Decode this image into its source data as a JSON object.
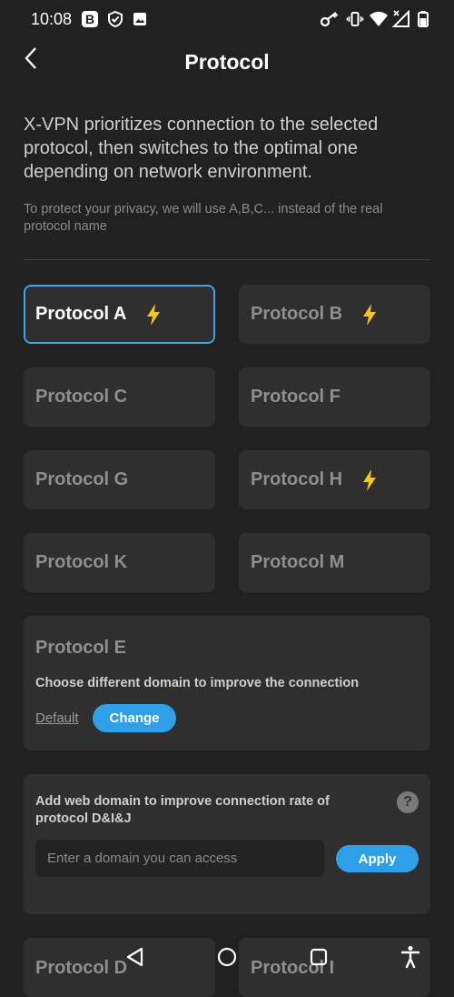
{
  "status_bar": {
    "time": "10:08",
    "badge_letter": "B",
    "left_icons": [
      "b-badge-icon",
      "shield-check-icon",
      "image-icon"
    ],
    "right_icons": [
      "key-icon",
      "vibrate-icon",
      "wifi-icon",
      "signal-icon",
      "battery-icon"
    ]
  },
  "header": {
    "title": "Protocol",
    "back_icon": "chevron-left-icon"
  },
  "intro": "X-VPN prioritizes connection to the selected protocol, then switches to the optimal one depending on network environment.",
  "privacy_note": "To protect your privacy, we will use A,B,C... instead of the real protocol name",
  "protocols": [
    {
      "label": "Protocol A",
      "fast": true,
      "selected": true
    },
    {
      "label": "Protocol B",
      "fast": true,
      "selected": false
    },
    {
      "label": "Protocol C",
      "fast": false,
      "selected": false
    },
    {
      "label": "Protocol F",
      "fast": false,
      "selected": false
    },
    {
      "label": "Protocol G",
      "fast": false,
      "selected": false
    },
    {
      "label": "Protocol H",
      "fast": true,
      "selected": false
    },
    {
      "label": "Protocol K",
      "fast": false,
      "selected": false
    },
    {
      "label": "Protocol M",
      "fast": false,
      "selected": false
    }
  ],
  "protocol_e": {
    "title": "Protocol E",
    "description": "Choose different domain to improve the connection",
    "default_label": "Default",
    "change_label": "Change"
  },
  "domain_card": {
    "text": "Add web domain to improve connection rate of protocol D&I&J",
    "help_label": "?",
    "input_placeholder": "Enter a domain you can access",
    "input_value": "",
    "apply_label": "Apply"
  },
  "bottom_protocols": [
    {
      "label": "Protocol D"
    },
    {
      "label": "Protocol I"
    }
  ],
  "nav_bar": [
    "back-triangle-icon",
    "home-circle-icon",
    "recents-square-icon",
    "accessibility-icon"
  ],
  "colors": {
    "background": "#212121",
    "card": "#2f2f2f",
    "accent": "#2f9fe8",
    "selected_border": "#3fa3e9",
    "bolt": "#f5c518"
  }
}
